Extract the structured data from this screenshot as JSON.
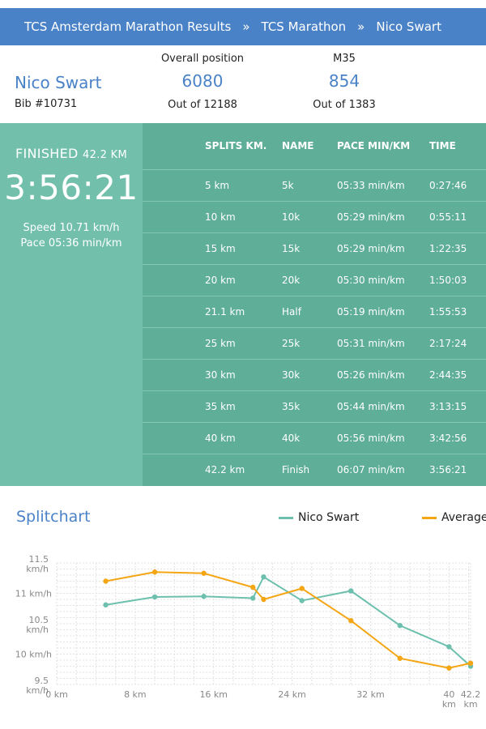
{
  "breadcrumb": {
    "items": [
      "TCS Amsterdam Marathon Results",
      "TCS Marathon",
      "Nico Swart"
    ],
    "separator": "»"
  },
  "runner": {
    "name": "Nico Swart",
    "bib": "Bib #10731"
  },
  "overall": {
    "label": "Overall position",
    "value": "6080",
    "out_of": "Out of 12188"
  },
  "category": {
    "label": "M35",
    "value": "854",
    "out_of": "Out of 1383"
  },
  "result": {
    "finished_label": "FINISHED",
    "distance": "42.2 KM",
    "time": "3:56:21",
    "speed": "Speed 10.71 km/h",
    "pace": "Pace 05:36 min/km"
  },
  "splits": {
    "headers": [
      "SPLITS KM.",
      "NAME",
      "PACE MIN/KM",
      "TIME"
    ],
    "rows": [
      [
        "5 km",
        "5k",
        "05:33 min/km",
        "0:27:46"
      ],
      [
        "10 km",
        "10k",
        "05:29 min/km",
        "0:55:11"
      ],
      [
        "15 km",
        "15k",
        "05:29 min/km",
        "1:22:35"
      ],
      [
        "20 km",
        "20k",
        "05:30 min/km",
        "1:50:03"
      ],
      [
        "21.1 km",
        "Half",
        "05:19 min/km",
        "1:55:53"
      ],
      [
        "25 km",
        "25k",
        "05:31 min/km",
        "2:17:24"
      ],
      [
        "30 km",
        "30k",
        "05:26 min/km",
        "2:44:35"
      ],
      [
        "35 km",
        "35k",
        "05:44 min/km",
        "3:13:15"
      ],
      [
        "40 km",
        "40k",
        "05:56 min/km",
        "3:42:56"
      ],
      [
        "42.2 km",
        "Finish",
        "06:07 min/km",
        "3:56:21"
      ]
    ]
  },
  "colors": {
    "accent_blue": "#4a82c8",
    "runner_line": "#6ec0ae",
    "average_line": "#f5a614"
  },
  "chart_data": {
    "type": "line",
    "title": "Splitchart",
    "x_ticks": [
      "0 km",
      "8 km",
      "16 km",
      "24 km",
      "32 km",
      "40 km",
      "42.2 km"
    ],
    "x_tick_values": [
      0,
      8,
      16,
      24,
      32,
      40,
      42.2
    ],
    "y_ticks": [
      "9.5 km/h",
      "10 km/h",
      "10.5 km/h",
      "11 km/h",
      "11.5 km/h"
    ],
    "y_tick_values": [
      9.5,
      10,
      10.5,
      11,
      11.5
    ],
    "xlim": [
      0,
      42.2
    ],
    "ylim": [
      9.5,
      11.5
    ],
    "grid": true,
    "legend_position": "top-right",
    "series": [
      {
        "name": "Nico Swart",
        "color": "#6ec0ae",
        "x": [
          5,
          10,
          15,
          20,
          21.1,
          25,
          30,
          35,
          40,
          42.2
        ],
        "y": [
          10.81,
          10.94,
          10.95,
          10.92,
          11.27,
          10.88,
          11.04,
          10.47,
          10.12,
          9.8
        ]
      },
      {
        "name": "Average",
        "color": "#f5a614",
        "x": [
          5,
          10,
          15,
          20,
          21.1,
          25,
          30,
          35,
          40,
          42.2
        ],
        "y": [
          11.2,
          11.35,
          11.33,
          11.1,
          10.9,
          11.08,
          10.55,
          9.93,
          9.77,
          9.85
        ]
      }
    ]
  }
}
